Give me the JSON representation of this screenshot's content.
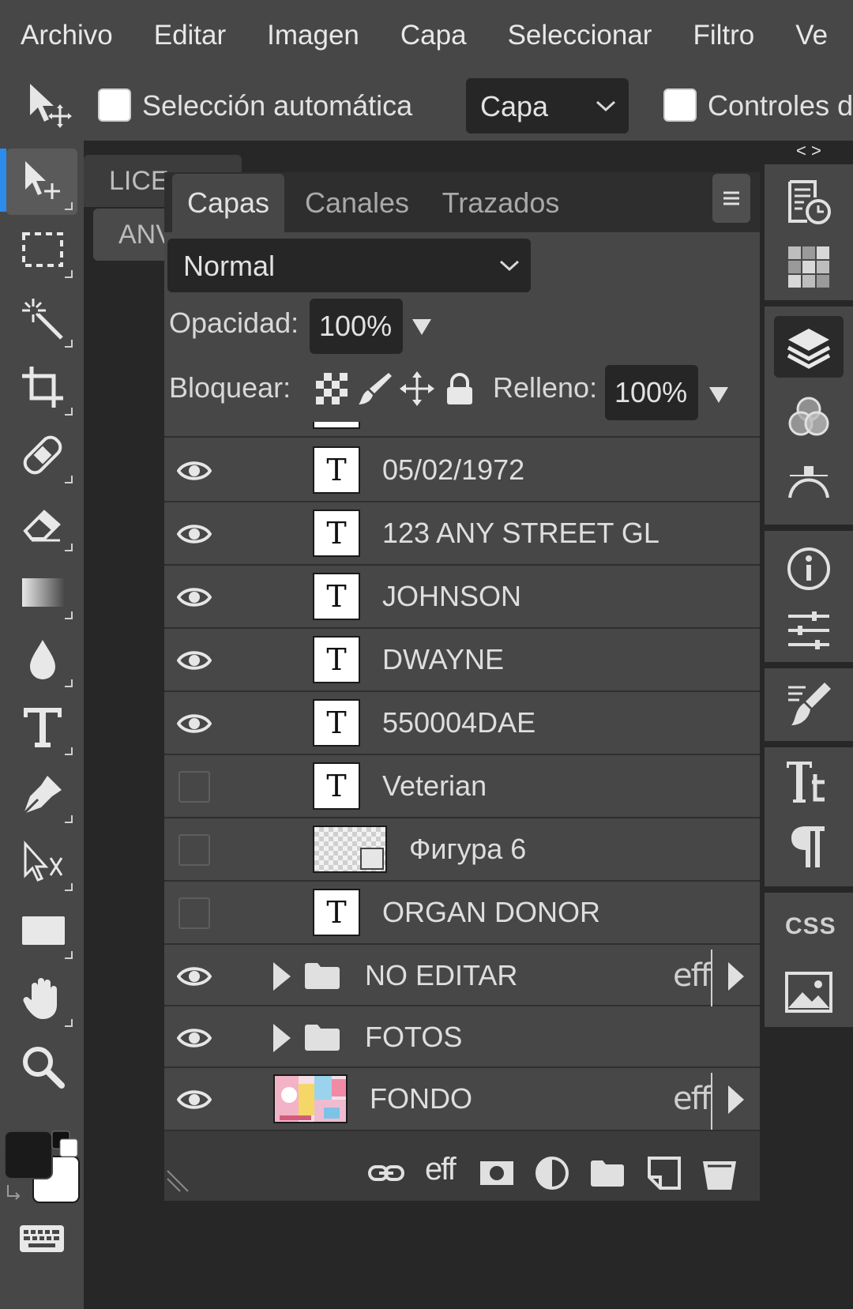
{
  "menubar": {
    "items": [
      "Archivo",
      "Editar",
      "Imagen",
      "Capa",
      "Seleccionar",
      "Filtro",
      "Ve"
    ]
  },
  "options": {
    "auto_select_label": "Selección automática",
    "auto_select_target": "Capa",
    "transform_controls_label": "Controles d"
  },
  "toolbar": {
    "tools": [
      "move-tool",
      "marquee-tool",
      "magic-wand-tool",
      "crop-tool",
      "healing-tool",
      "eraser-tool",
      "gradient-tool",
      "blur-tool",
      "type-tool",
      "pen-tool",
      "path-select-tool",
      "shape-tool",
      "hand-tool",
      "zoom-tool"
    ],
    "active_tool": "move-tool",
    "foreground_color": "#1a1a1a",
    "background_color": "#ffffff"
  },
  "document": {
    "tabs": [
      "LICE",
      "ANV"
    ]
  },
  "layers_panel": {
    "tabs": [
      "Capas",
      "Canales",
      "Trazados"
    ],
    "active_tab": "Capas",
    "blend_mode": "Normal",
    "opacity_label": "Opacidad:",
    "opacity_value": "100%",
    "lock_label": "Bloquear:",
    "fill_label": "Relleno:",
    "fill_value": "100%",
    "fx_label": "eff",
    "layers": [
      {
        "name": "05/02/1972",
        "kind": "text",
        "visible": true
      },
      {
        "name": "123 ANY STREET GL",
        "kind": "text",
        "visible": true
      },
      {
        "name": "JOHNSON",
        "kind": "text",
        "visible": true
      },
      {
        "name": "DWAYNE",
        "kind": "text",
        "visible": true
      },
      {
        "name": "550004DAE",
        "kind": "text",
        "visible": true
      },
      {
        "name": "Veterian",
        "kind": "text",
        "visible": false
      },
      {
        "name": "Фигура 6",
        "kind": "shape",
        "visible": false
      },
      {
        "name": "ORGAN DONOR",
        "kind": "text",
        "visible": false
      },
      {
        "name": "NO EDITAR",
        "kind": "group",
        "visible": true,
        "has_effects": true
      },
      {
        "name": "FOTOS",
        "kind": "group",
        "visible": true,
        "has_effects": false
      },
      {
        "name": "FONDO",
        "kind": "image",
        "visible": true,
        "has_effects": true
      }
    ],
    "text_thumb_glyph": "T"
  },
  "rightbar": {
    "collapse_label": "< >",
    "css_label": "CSS"
  },
  "colors": {
    "accent": "#2d8ceb",
    "panel": "#474747",
    "dark": "#272727"
  }
}
